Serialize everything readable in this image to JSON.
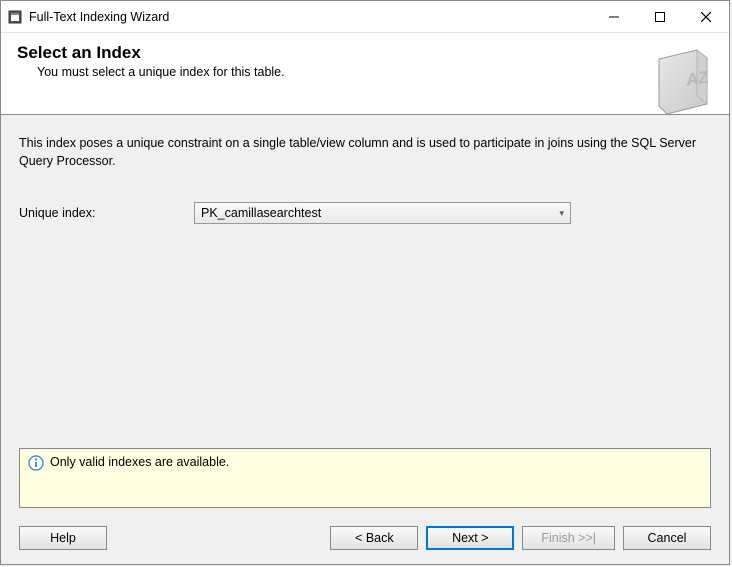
{
  "window": {
    "title": "Full-Text Indexing Wizard"
  },
  "header": {
    "title": "Select an Index",
    "subtitle": "You must select a unique index for this table."
  },
  "content": {
    "description": "This index poses a unique constraint on a single table/view column and is used to participate in joins using the SQL Server Query Processor.",
    "index_label": "Unique index:",
    "index_value": "PK_camillasearchtest"
  },
  "info": {
    "message": "Only valid indexes are available."
  },
  "footer": {
    "help": "Help",
    "back": "< Back",
    "next": "Next >",
    "finish": "Finish >>|",
    "cancel": "Cancel"
  }
}
